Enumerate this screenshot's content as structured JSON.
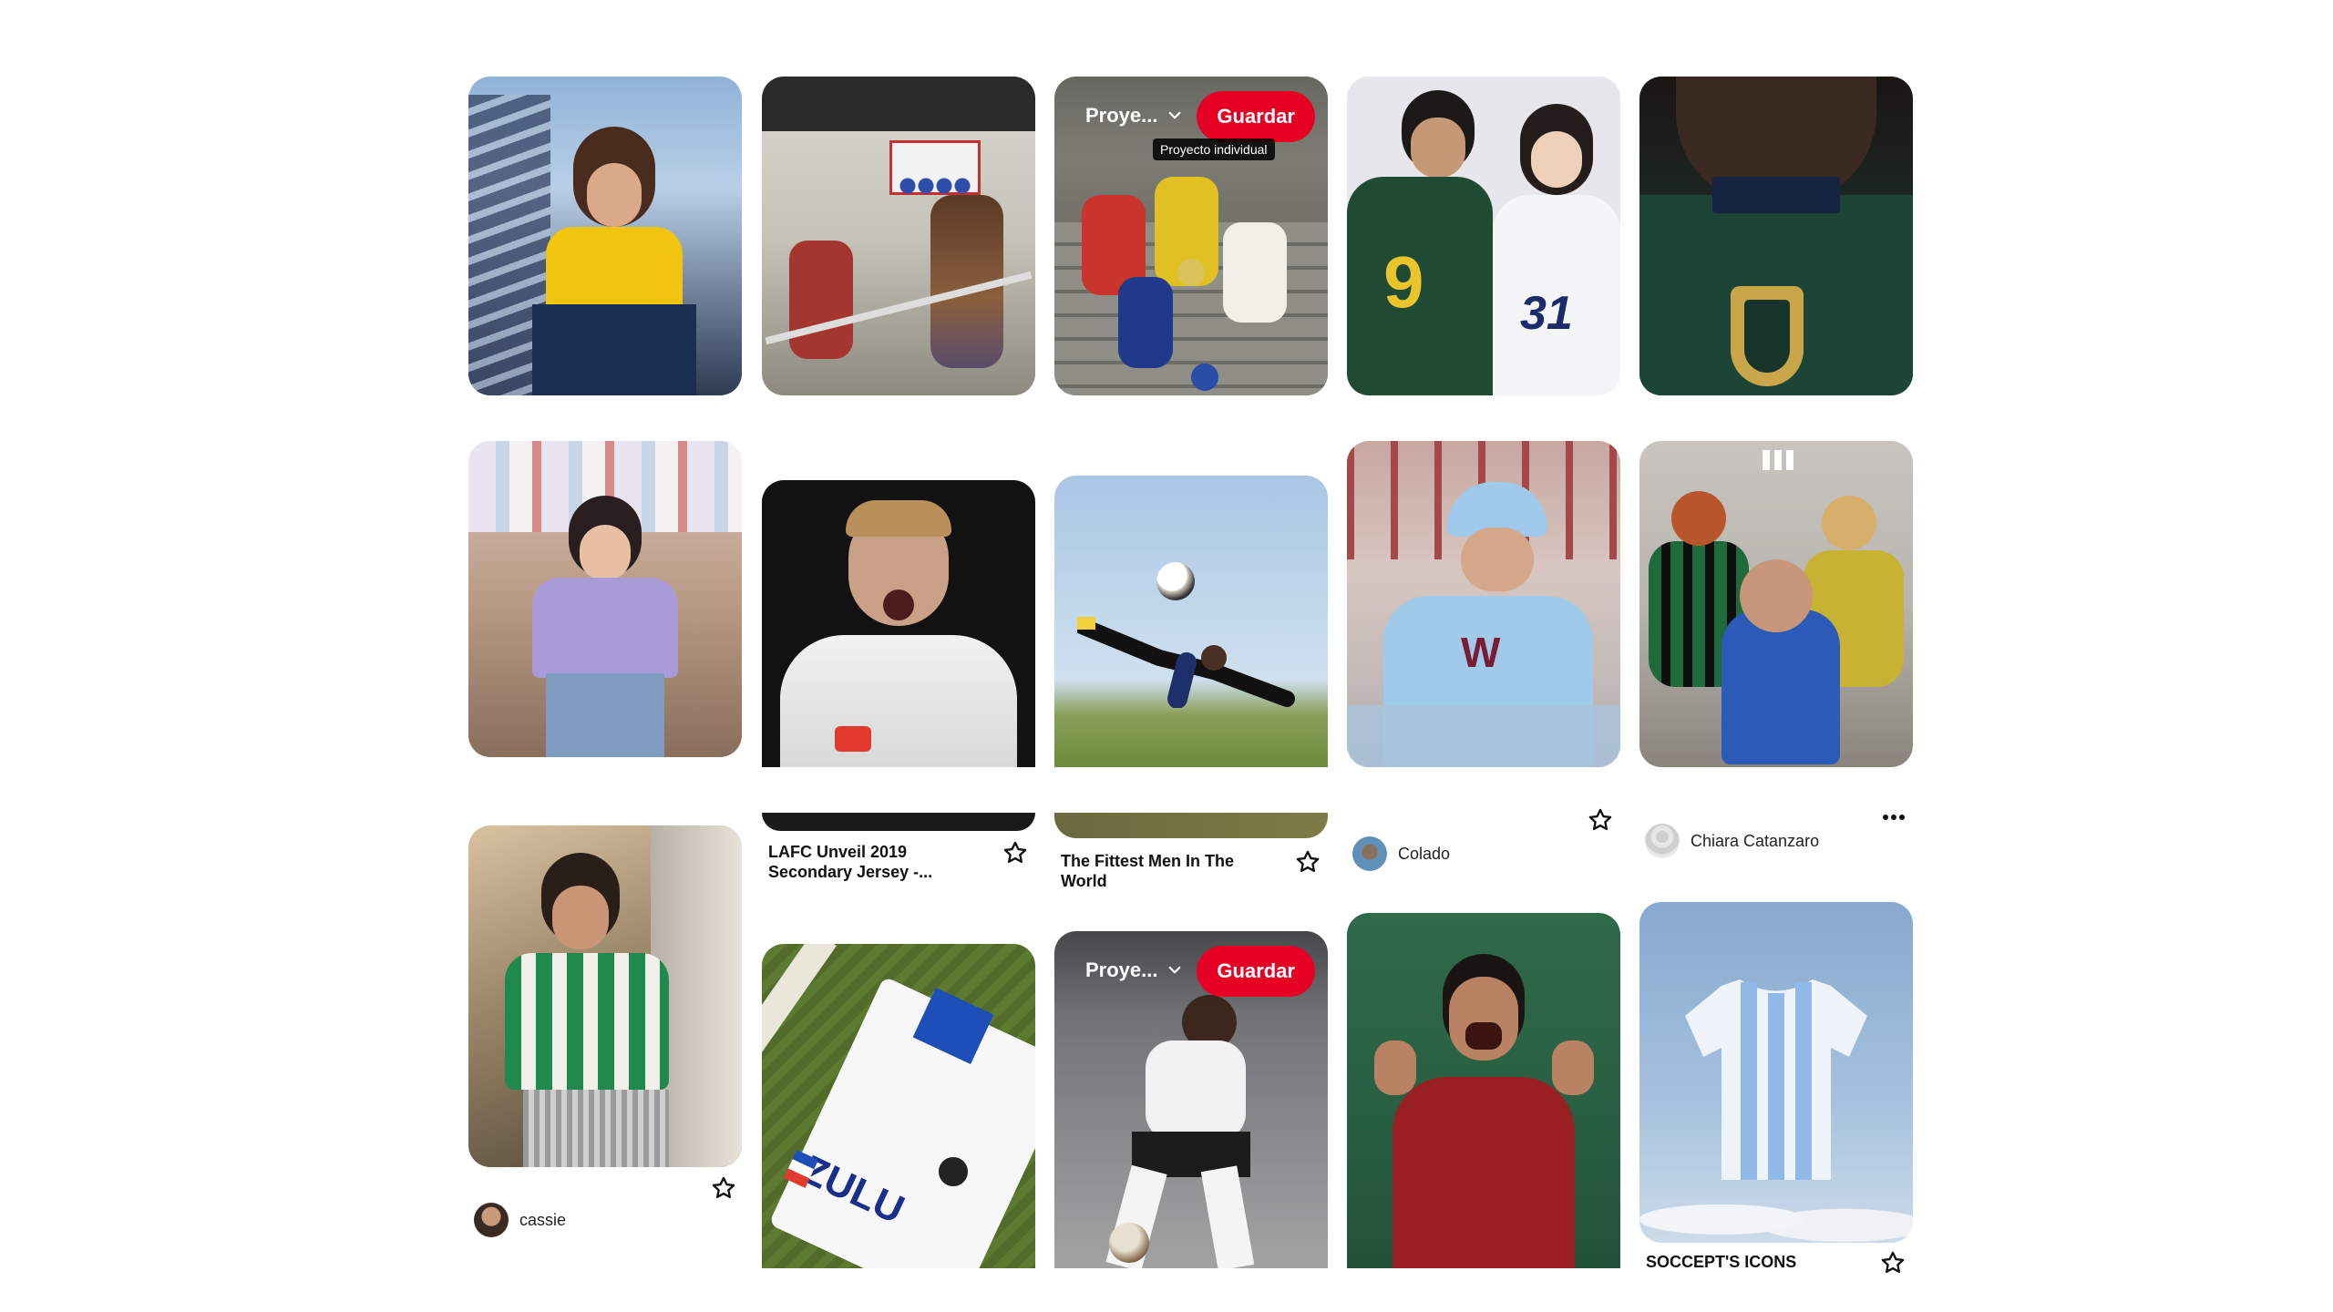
{
  "pins": {
    "p1": {
      "alt": ""
    },
    "p7": {
      "title": "LAFC Unveil 2019 Secondary Jersey -..."
    },
    "p8": {
      "title": "The Fittest Men In The World"
    },
    "p9": {
      "user": "Colado"
    },
    "p10": {
      "user": "Chiara Catanzaro"
    },
    "p11": {
      "user": "cassie"
    },
    "p15": {
      "title": "SOCCEPT'S ICONS"
    }
  },
  "hover": {
    "board_label": "Proye...",
    "save_label": "Guardar",
    "tooltip": "Proyecto individual"
  },
  "colors": {
    "save": "#e60023"
  },
  "icons": {
    "star": "star-outline-icon",
    "chevron": "chevron-down-icon",
    "more": "more-icon"
  }
}
